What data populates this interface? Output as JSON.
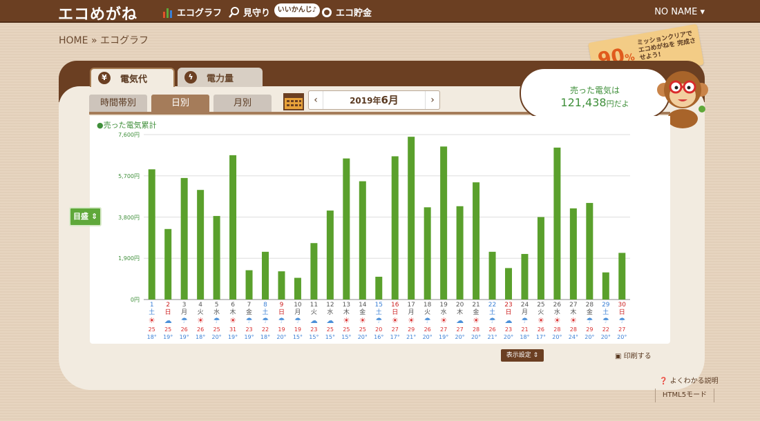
{
  "header": {
    "logo": "エコめがね",
    "nav": [
      {
        "label": "エコグラフ",
        "icon": "bar-chart-icon"
      },
      {
        "label": "見守り",
        "icon": "magnifier-icon"
      },
      {
        "label": "エコ貯金",
        "icon": "coin-icon"
      }
    ],
    "bubble": "いいかんじ♪",
    "user": "NO NAME"
  },
  "breadcrumb": {
    "home": "HOME",
    "sep": "»",
    "current": "エコグラフ"
  },
  "mission": {
    "percent": "90",
    "unit": "%",
    "text": "ミッションクリアで エコめがねを 完成させよう!"
  },
  "tabs": {
    "main": [
      "電気代",
      "電力量"
    ],
    "sub": [
      "時間帯別",
      "日別",
      "月別"
    ]
  },
  "month": {
    "year_label": "2019年",
    "month_label": "6月",
    "prev": "‹",
    "next": "›"
  },
  "speech": {
    "line1": "売った電気は",
    "amount": "121,438",
    "suffix": "円だよ"
  },
  "legend": "●売った電気累計",
  "target_button": "目盛",
  "display_button": "表示設定",
  "print_button": "印刷する",
  "help_link": "よくわかる説明",
  "html5_link": "HTML5モード",
  "colors": {
    "bar": "#5aa02c",
    "brown": "#6b3f22",
    "sat": "#3a7fd5",
    "sun": "#cc1f1f"
  },
  "chart_data": {
    "type": "bar",
    "series": [
      {
        "name": "売った電気累計",
        "values": [
          6000,
          3250,
          5600,
          5050,
          3850,
          6650,
          1350,
          2200,
          1300,
          1000,
          2600,
          4100,
          6500,
          5450,
          1050,
          6600,
          7500,
          4250,
          7050,
          4300,
          5400,
          2200,
          1450,
          2100,
          3800,
          7000,
          4200,
          4450,
          1250,
          2150
        ]
      }
    ],
    "ylim": [
      0,
      7600
    ],
    "yticks": [
      "0円",
      "1,900円",
      "3,800円",
      "5,700円",
      "7,600円"
    ],
    "days": [
      "1",
      "2",
      "3",
      "4",
      "5",
      "6",
      "7",
      "8",
      "9",
      "10",
      "11",
      "12",
      "13",
      "14",
      "15",
      "16",
      "17",
      "18",
      "19",
      "20",
      "21",
      "22",
      "23",
      "24",
      "25",
      "26",
      "27",
      "28",
      "29",
      "30"
    ],
    "weekdays": [
      "土",
      "日",
      "月",
      "火",
      "水",
      "木",
      "金",
      "土",
      "日",
      "月",
      "火",
      "水",
      "木",
      "金",
      "土",
      "日",
      "月",
      "火",
      "水",
      "木",
      "金",
      "土",
      "日",
      "月",
      "火",
      "水",
      "木",
      "金",
      "土",
      "日"
    ],
    "weather": [
      "sun",
      "cloud",
      "rain",
      "sun",
      "rain",
      "sun",
      "rain",
      "rain",
      "rain",
      "rain",
      "cloud",
      "cloud",
      "sun",
      "sun",
      "rain",
      "sun",
      "sun",
      "rain",
      "sun",
      "cloud",
      "sun",
      "rain",
      "cloud",
      "rain",
      "sun",
      "sun",
      "sun",
      "rain",
      "rain",
      "rain"
    ],
    "high": [
      "25",
      "25",
      "26",
      "26",
      "25",
      "31",
      "23",
      "22",
      "19",
      "19",
      "23",
      "25",
      "25",
      "25",
      "20",
      "27",
      "29",
      "26",
      "27",
      "27",
      "28",
      "26",
      "23",
      "21",
      "26",
      "28",
      "28",
      "29",
      "22",
      "27"
    ],
    "low": [
      "18",
      "19",
      "19",
      "18",
      "20",
      "19",
      "19",
      "18",
      "20",
      "15",
      "15",
      "15",
      "15",
      "20",
      "16",
      "17",
      "21",
      "20",
      "19",
      "20",
      "20",
      "21",
      "20",
      "18",
      "17",
      "20",
      "24",
      "20",
      "20",
      "20"
    ]
  }
}
